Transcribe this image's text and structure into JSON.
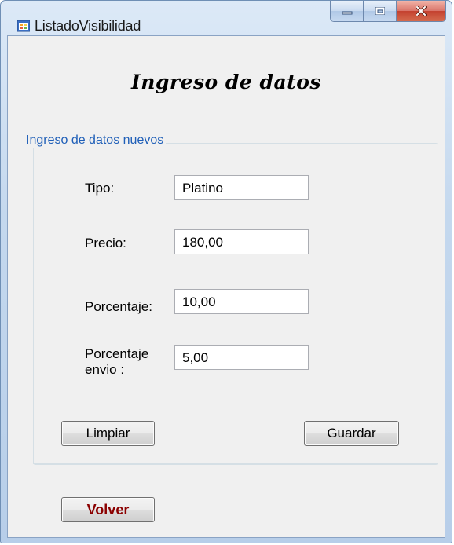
{
  "window": {
    "title": "ListadoVisibilidad"
  },
  "form": {
    "heading": "Ingreso de datos",
    "group_title": "Ingreso de datos nuevos",
    "fields": [
      {
        "label": "Tipo:",
        "value": "Platino"
      },
      {
        "label": "Precio:",
        "value": "180,00"
      },
      {
        "label": "Porcentaje:",
        "value": "10,00"
      },
      {
        "label": "Porcentaje\nenvio :",
        "value": "5,00"
      }
    ],
    "buttons": {
      "clear": "Limpiar",
      "save": "Guardar",
      "back": "Volver"
    }
  },
  "colors": {
    "group_title": "#1f5fb8",
    "back_button_text": "#8b0000"
  }
}
